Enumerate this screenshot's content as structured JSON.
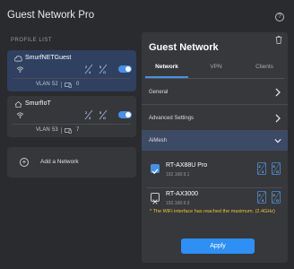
{
  "app": {
    "title": "Guest Network Pro"
  },
  "sidebar": {
    "section_label": "PROFILE LIST",
    "profiles": [
      {
        "name": "SmurfNETGuest",
        "vlan_label": "VLAN",
        "vlan": "52",
        "devices": "0",
        "enabled": true,
        "selected": true
      },
      {
        "name": "SmurfIoT",
        "vlan_label": "VLAN",
        "vlan": "53",
        "devices": "7",
        "enabled": true,
        "selected": false
      }
    ],
    "add_label": "Add a Network"
  },
  "panel": {
    "title": "Guest Network",
    "tabs": [
      {
        "label": "Network",
        "active": true
      },
      {
        "label": "VPN",
        "active": false
      },
      {
        "label": "Clients",
        "active": false
      }
    ],
    "rows": [
      {
        "label": "General"
      },
      {
        "label": "Advanced Settings"
      }
    ],
    "aimesh": {
      "label": "AiMesh",
      "nodes": [
        {
          "name": "RT-AX88U Pro",
          "ip": "192.168.9.1",
          "checked": true
        },
        {
          "name": "RT-AX3000",
          "ip": "192.168.9.3",
          "checked": false
        }
      ],
      "warning": "* The WiFi interface has reached the maximum. (2.4GHz)"
    },
    "apply_label": "Apply"
  },
  "colors": {
    "accent": "#2e8ff5",
    "warning": "#e8c33a",
    "selected_card": "#2f4060"
  },
  "icons": [
    "help-icon",
    "wifi-icon",
    "device-icon",
    "trash-icon",
    "chevron-right-icon",
    "chevron-down-icon",
    "plus-icon",
    "check-icon",
    "close-icon",
    "band-2g-icon",
    "band-5g-icon"
  ]
}
